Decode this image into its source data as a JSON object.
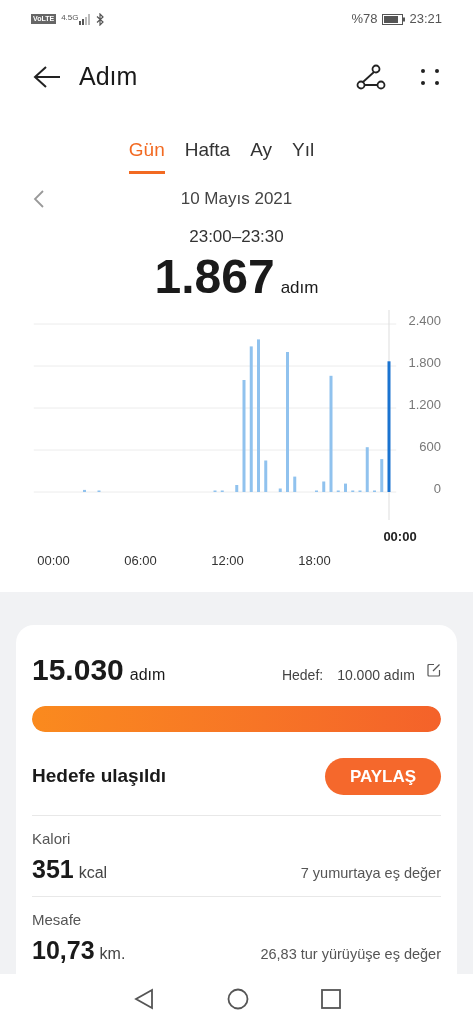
{
  "status_bar": {
    "volte": "VoLTE",
    "network": "4.5G",
    "battery": "%78",
    "time": "23:21"
  },
  "header": {
    "title": "Adım"
  },
  "tabs": [
    {
      "label": "Gün",
      "selected": true
    },
    {
      "label": "Hafta",
      "selected": false
    },
    {
      "label": "Ay",
      "selected": false
    },
    {
      "label": "Yıl",
      "selected": false
    }
  ],
  "date": "10 Mayıs 2021",
  "selected_range": "23:00–23:30",
  "selected_value": "1.867",
  "selected_unit": "adım",
  "chart_cursor_label": "00:00",
  "chart_data": {
    "type": "bar",
    "grid": true,
    "xlim": [
      -1.5,
      23.5
    ],
    "ylim": [
      0,
      2400
    ],
    "x": [
      2,
      3,
      11,
      11.5,
      12.5,
      13,
      13.5,
      14,
      14.5,
      15.5,
      16,
      16.5,
      18,
      18.5,
      19,
      19.5,
      20,
      20.5,
      21,
      21.5,
      22,
      22.5,
      23
    ],
    "series": [
      {
        "color": "#90c2ee",
        "values": [
          30,
          10,
          10,
          10,
          100,
          1600,
          2080,
          2180,
          450,
          50,
          2000,
          220,
          10,
          150,
          1660,
          10,
          120,
          10,
          10,
          640,
          10,
          470,
          null
        ]
      },
      {
        "color": "#1a73d0",
        "values": [
          null,
          null,
          null,
          null,
          null,
          null,
          null,
          null,
          null,
          null,
          null,
          null,
          null,
          null,
          null,
          null,
          null,
          null,
          null,
          null,
          null,
          null,
          1867
        ]
      }
    ],
    "yticks": [
      {
        "value": 0,
        "label": "0"
      },
      {
        "value": 600,
        "label": "600"
      },
      {
        "value": 1200,
        "label": "1.200"
      },
      {
        "value": 1800,
        "label": "1.800"
      },
      {
        "value": 2400,
        "label": "2.400"
      }
    ],
    "xticks": [
      {
        "value": 0,
        "label": "00:00"
      },
      {
        "value": 6,
        "label": "06:00"
      },
      {
        "value": 12,
        "label": "12:00"
      },
      {
        "value": 18,
        "label": "18:00"
      }
    ]
  },
  "summary": {
    "value": "15.030",
    "unit": "adım",
    "goal_label": "Hedef:",
    "goal_value": "10.000 adım",
    "level": 1
  },
  "goal_message": "Hedefe ulaşıldı",
  "share_button": "PAYLAŞ",
  "stats": [
    {
      "label": "Kalori",
      "value": "351",
      "unit": "kcal",
      "note": "7 yumurtaya eş değer"
    },
    {
      "label": "Mesafe",
      "value": "10,73",
      "unit": "km.",
      "note": "26,83 tur yürüyüşe eş değer"
    }
  ]
}
